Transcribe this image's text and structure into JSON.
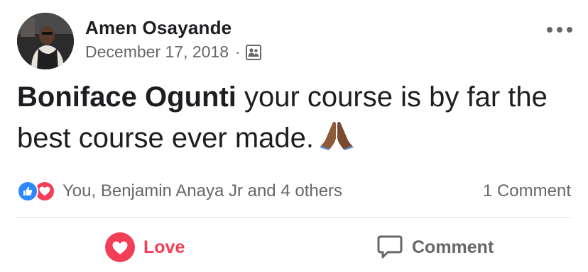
{
  "post": {
    "author": "Amen Osayande",
    "date": "December 17, 2018",
    "separator": "·",
    "audience_icon": "friends-group-icon",
    "message": {
      "mention": "Boniface Ogunti",
      "text": " your course is by far the best course ever made.",
      "emoji": "folded-hands-emoji"
    }
  },
  "reactions": {
    "icons": [
      "like-reaction-icon",
      "love-reaction-icon"
    ],
    "names": "You, Benjamin Anaya Jr and 4 others",
    "comment_count": "1 Comment"
  },
  "actions": {
    "love_label": "Love",
    "comment_label": "Comment"
  },
  "colors": {
    "love": "#f33e58",
    "like": "#2d88ff",
    "secondary_text": "#65676b",
    "primary_text": "#1c1e21"
  }
}
